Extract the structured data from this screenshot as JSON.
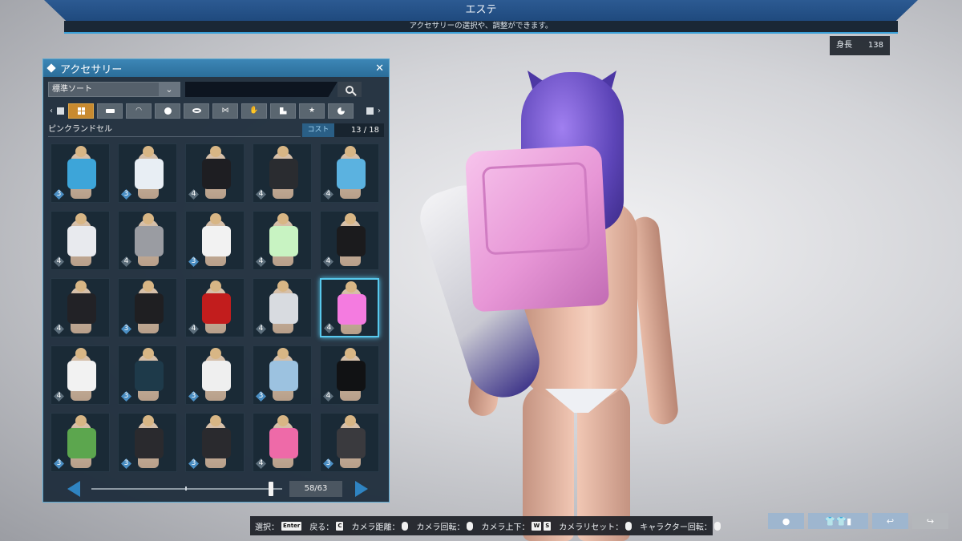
{
  "header": {
    "title": "エステ",
    "subtitle": "アクセサリーの選択や、調整ができます。"
  },
  "height": {
    "label": "身長",
    "value": "138"
  },
  "panel": {
    "title": "アクセサリー",
    "sort_value": "標準ソート",
    "search_value": "",
    "categories": [
      {
        "icon": "grid-icon",
        "active": true
      },
      {
        "icon": "rect-icon",
        "active": false
      },
      {
        "icon": "wing-icon",
        "active": false
      },
      {
        "icon": "face-icon",
        "active": false
      },
      {
        "icon": "ring-icon",
        "active": false
      },
      {
        "icon": "bow-icon",
        "active": false
      },
      {
        "icon": "hand-icon",
        "active": false
      },
      {
        "icon": "boot-icon",
        "active": false
      },
      {
        "icon": "star-icon",
        "active": false
      },
      {
        "icon": "pie-icon",
        "active": false
      }
    ],
    "item_name": "ピンクランドセル",
    "cost_label": "コスト",
    "cost_value": "13 /  18",
    "items": [
      {
        "rank": "3",
        "color": "#3da5d9"
      },
      {
        "rank": "3",
        "color": "#e8eef4"
      },
      {
        "rank": "4",
        "color": "#1e1e22"
      },
      {
        "rank": "4",
        "color": "#2a2c30"
      },
      {
        "rank": "4",
        "color": "#5bb2e0"
      },
      {
        "rank": "4",
        "color": "#e8eaee"
      },
      {
        "rank": "4",
        "color": "#9a9ca2"
      },
      {
        "rank": "3",
        "color": "#f2f2f2"
      },
      {
        "rank": "4",
        "color": "#c8f3c2"
      },
      {
        "rank": "4",
        "color": "#1b1b1d"
      },
      {
        "rank": "4",
        "color": "#222226"
      },
      {
        "rank": "3",
        "color": "#1f1f22"
      },
      {
        "rank": "4",
        "color": "#c21d1d"
      },
      {
        "rank": "4",
        "color": "#d8dbe0"
      },
      {
        "rank": "4",
        "color": "#f47be0",
        "selected": true
      },
      {
        "rank": "4",
        "color": "#f2f2f2"
      },
      {
        "rank": "3",
        "color": "#1e3a4a"
      },
      {
        "rank": "3",
        "color": "#efefef"
      },
      {
        "rank": "3",
        "color": "#9cc2e0"
      },
      {
        "rank": "4",
        "color": "#111214"
      },
      {
        "rank": "3",
        "color": "#5ca64e"
      },
      {
        "rank": "3",
        "color": "#2a2a2e"
      },
      {
        "rank": "3",
        "color": "#2a2a2e"
      },
      {
        "rank": "4",
        "color": "#ee6aa8"
      },
      {
        "rank": "3",
        "color": "#3a3a3e"
      }
    ],
    "page_count": "58/63",
    "scroll_fraction": 0.97
  },
  "help_bar": [
    {
      "label": "選択：",
      "key": "Enter"
    },
    {
      "label": "戻る：",
      "key": "C"
    },
    {
      "label": "カメラ距離：",
      "key": "mouse"
    },
    {
      "label": "カメラ回転：",
      "key": "mouse"
    },
    {
      "label": "カメラ上下：",
      "key": "W S"
    },
    {
      "label": "カメラリセット：",
      "key": "mouse"
    },
    {
      "label": "キャラクター回転：",
      "key": "mouse"
    }
  ]
}
